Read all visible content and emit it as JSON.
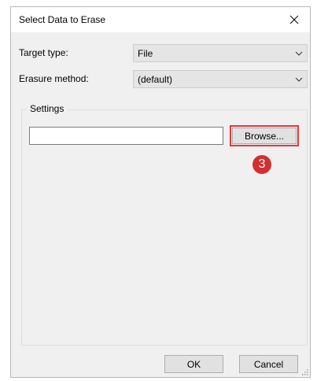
{
  "dialog": {
    "title": "Select Data to Erase",
    "close_glyph": "✕"
  },
  "target_type": {
    "label": "Target type:",
    "value": "File"
  },
  "erasure_method": {
    "label": "Erasure method:",
    "value": "(default)"
  },
  "settings": {
    "group_label": "Settings",
    "path_value": "",
    "browse_label": "Browse...",
    "step_number": "3"
  },
  "buttons": {
    "ok_label": "OK",
    "cancel_label": "Cancel"
  },
  "colors": {
    "highlight": "#e53935",
    "badge": "#d32f2f"
  },
  "icons": {
    "close": "close-icon",
    "dropdown": "chevron-down-icon",
    "resize": "resize-grip-icon"
  }
}
